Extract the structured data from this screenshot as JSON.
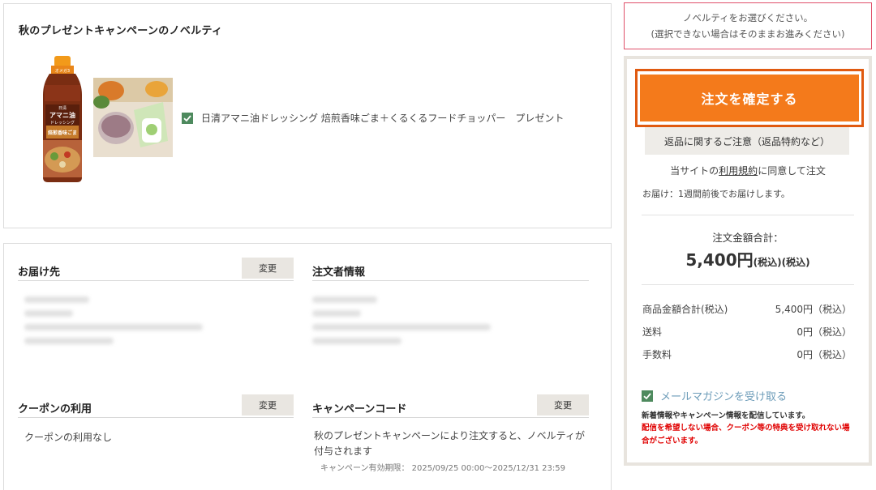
{
  "novelty": {
    "title": "秋のプレゼントキャンペーンのノベルティ",
    "product_label": "日清アマニ油ドレッシング 焙煎香味ごま＋くるくるフードチョッパー　プレゼント",
    "checked": true,
    "bottle_badge": "オメガ3",
    "bottle_brand": "日清",
    "bottle_name": "アマニ油",
    "bottle_sub": "ドレッシング",
    "bottle_flavor": "焙煎香味ごま"
  },
  "shipping": {
    "heading": "お届け先",
    "change_label": "変更"
  },
  "orderer": {
    "heading": "注文者情報"
  },
  "coupon": {
    "heading": "クーポンの利用",
    "change_label": "変更",
    "value": "クーポンの利用なし"
  },
  "campaign": {
    "heading": "キャンペーンコード",
    "change_label": "変更",
    "description": "秋のプレゼントキャンペーンにより注文すると、ノベルティが付与されます",
    "period": "キャンペーン有効期限： 2025/09/25 00:00〜2025/12/31 23:59"
  },
  "notice": {
    "line1": "ノベルティをお選びください。",
    "line2": "(選択できない場合はそのままお進みください)"
  },
  "summary": {
    "confirm_label": "注文を確定する",
    "return_policy_label": "返品に関するご注意（返品特約など）",
    "agree_prefix": "当サイトの",
    "agree_link": "利用規約",
    "agree_suffix": "に同意して注文",
    "delivery": "お届け：1週間前後でお届けします。",
    "total_label": "注文金額合計：",
    "total_amount": "5,400円",
    "total_tax1": "(税込)",
    "total_tax2": "(税込)",
    "rows": [
      {
        "label": "商品金額合計(税込)",
        "value": "5,400円（税込）"
      },
      {
        "label": "送料",
        "value": "0円（税込）"
      },
      {
        "label": "手数料",
        "value": "0円（税込）"
      }
    ],
    "newsletter_label": "メールマガジンを受け取る",
    "newsletter_checked": true,
    "newsletter_desc": "新着情報やキャンペーン情報を配信しています。",
    "newsletter_warn": "配信を希望しない場合、クーポン等の特典を受け取れない場合がございます。"
  },
  "colors": {
    "accent_orange": "#f47a1b",
    "notice_border": "#e0506a",
    "check_green": "#4e8a5e",
    "warn_red": "#e00000"
  }
}
